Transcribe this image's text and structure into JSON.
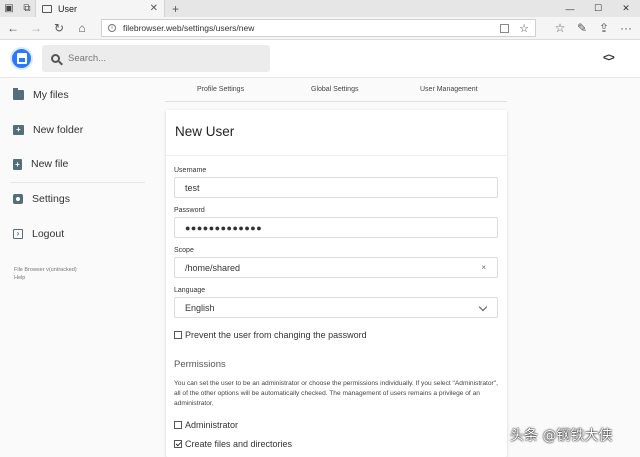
{
  "browser": {
    "tab_title": "User",
    "url": "filebrowser.web/settings/users/new",
    "new_tab": "+"
  },
  "header": {
    "search_placeholder": "Search...",
    "code_toggle": "<>"
  },
  "sidebar": {
    "items": [
      {
        "label": "My files",
        "icon": "folder-icon"
      },
      {
        "label": "New folder",
        "icon": "create-new-folder-icon"
      },
      {
        "label": "New file",
        "icon": "note-add-icon"
      },
      {
        "label": "Settings",
        "icon": "settings-icon"
      },
      {
        "label": "Logout",
        "icon": "exit-icon"
      }
    ],
    "footer_line1": "File Browser v(untracked)",
    "footer_line2": "Help"
  },
  "settings_tabs": [
    "Profile Settings",
    "Global Settings",
    "User Management"
  ],
  "form": {
    "title": "New User",
    "username_label": "Username",
    "username_value": "test",
    "password_label": "Password",
    "password_value": "●●●●●●●●●●●●●",
    "scope_label": "Scope",
    "scope_value": "/home/shared",
    "scope_clear": "×",
    "language_label": "Language",
    "language_value": "English",
    "prevent_password_change": "Prevent the user from changing the password",
    "prevent_password_change_checked": false,
    "permissions_title": "Permissions",
    "permissions_text": "You can set the user to be an administrator or choose the permissions individually. If you select \"Administrator\", all of the other options will be automatically checked. The management of users remains a privilege of an administrator.",
    "admin_label": "Administrator",
    "admin_checked": false,
    "create_label": "Create files and directories",
    "create_checked": true
  },
  "watermark": "头条 @钢铁大侠"
}
